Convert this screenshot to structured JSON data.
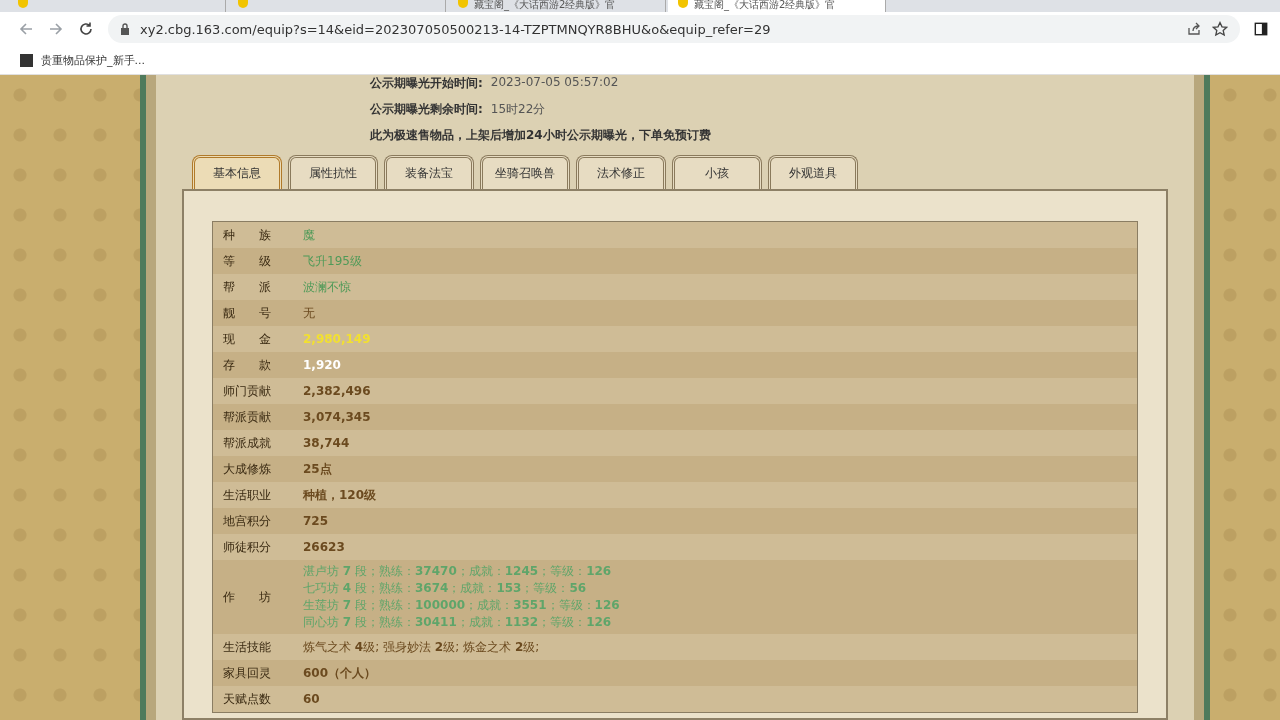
{
  "browser": {
    "tabs": [
      {
        "selected": false
      },
      {
        "selected": false
      },
      {
        "title": "藏宝阁_《大话西游2经典版》官",
        "selected": false
      },
      {
        "title": "藏宝阁_《大话西游2经典版》官",
        "selected": true
      }
    ],
    "url": "xy2.cbg.163.com/equip?s=14&eid=202307050500213-14-TZPTMNQYR8BHU&o&equip_refer=29",
    "bookmarks": [
      "贵重物品保护_新手..."
    ]
  },
  "notice": [
    {
      "label": "公示期曝光开始时间:",
      "value": "2023-07-05 05:57:02"
    },
    {
      "label": "公示期曝光剩余时间:",
      "value": "15时22分"
    }
  ],
  "notice_note": "此为极速售物品，上架后增加**24**小时公示期曝光，下单免预订费",
  "tabs": [
    {
      "label": "基本信息",
      "selected": true
    },
    {
      "label": "属性抗性",
      "selected": false
    },
    {
      "label": "装备法宝",
      "selected": false
    },
    {
      "label": "坐骑召唤兽",
      "selected": false
    },
    {
      "label": "法术修正",
      "selected": false
    },
    {
      "label": "小孩",
      "selected": false
    },
    {
      "label": "外观道具",
      "selected": false
    }
  ],
  "rows": [
    {
      "label": "种　　族",
      "kind": "green",
      "value": "魔"
    },
    {
      "label": "等　　级",
      "kind": "green",
      "value": "飞升195级"
    },
    {
      "label": "帮　　派",
      "kind": "green",
      "value": "波澜不惊"
    },
    {
      "label": "靓　　号",
      "kind": "plain",
      "value": "无"
    },
    {
      "label": "现　　金",
      "kind": "gold",
      "value": "2,980,149"
    },
    {
      "label": "存　　款",
      "kind": "white",
      "value": "1,920"
    },
    {
      "label": "师门贡献",
      "kind": "bold",
      "value": "2,382,496"
    },
    {
      "label": "帮派贡献",
      "kind": "bold",
      "value": "3,074,345"
    },
    {
      "label": "帮派成就",
      "kind": "bold",
      "value": "38,744"
    },
    {
      "label": "大成修炼",
      "kind": "bold",
      "value": "25点"
    },
    {
      "label": "生活职业",
      "kind": "bold",
      "value": "种植，120级"
    },
    {
      "label": "地宫积分",
      "kind": "bold",
      "value": "725"
    },
    {
      "label": "师徒积分",
      "kind": "bold",
      "value": "26623"
    },
    {
      "label": "作　　坊",
      "kind": "lines",
      "lines": [
        "湛卢坊 **7** 段；熟练：**37470**；成就：**1245**；等级：**126**",
        "七巧坊 **4** 段；熟练：**3674**；成就：**153**；等级：**56**",
        "生莲坊 **7** 段；熟练：**100000**；成就：**3551**；等级：**126**",
        "同心坊 **7** 段；熟练：**30411**；成就：**1132**；等级：**126**"
      ]
    },
    {
      "label": "生活技能",
      "kind": "mixed",
      "value": "炼气之术 **4**级; 强身妙法 **2**级; 炼金之术 **2**级;"
    },
    {
      "label": "家具回灵",
      "kind": "bold",
      "value": "600（个人）"
    },
    {
      "label": "天赋点数",
      "kind": "bold",
      "value": "60"
    }
  ]
}
